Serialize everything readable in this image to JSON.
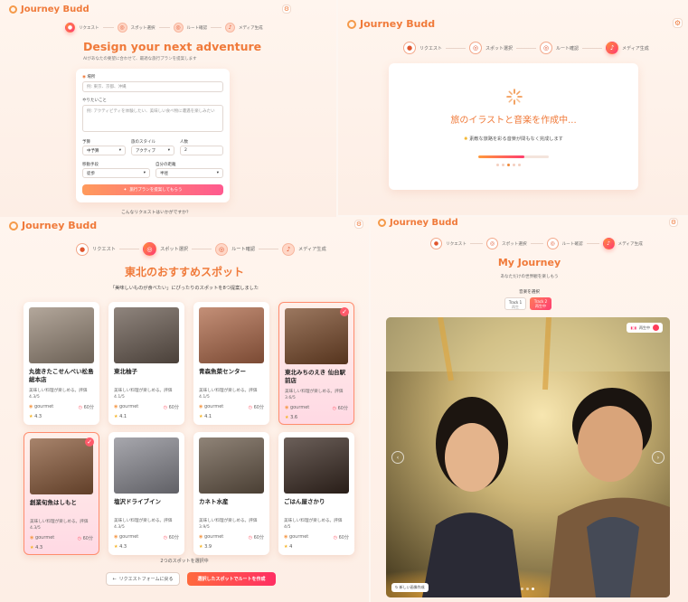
{
  "brand": {
    "name": "Journey Budd"
  },
  "steps": [
    "リクエスト",
    "スポット選択",
    "ルート確認",
    "メディア生成"
  ],
  "panel1": {
    "title": "Design your next adventure",
    "subtitle": "AIがあなたの要望に合わせて、最適な旅行プランを提案します",
    "destination_label": "場所",
    "destination_placeholder": "例: 東京、京都、沖縄",
    "request_label": "やりたいこと",
    "request_placeholder": "例: アクティビティを体験したい、美味しい食べ物に遭遇を楽しみたい",
    "budget_label": "予算",
    "budget_value": "中予算",
    "style_label": "旅のスタイル",
    "style_value": "アクティブ",
    "people_label": "人数",
    "people_value": "2",
    "transport_label": "移動手段",
    "transport_value": "徒歩",
    "distance_label": "自分の距離",
    "distance_value": "半径",
    "submit_label": "旅行プランを提案してもらう",
    "footer": "こんなリクエストはいかがですか？"
  },
  "panel2": {
    "title": "旅のイラストと音楽を作成中...",
    "subtitle": "素敵な旅路を彩る音楽が間もなく完成します",
    "progress": 0.65
  },
  "panel3": {
    "title": "東北のおすすめスポット",
    "subtitle": "「美味しいものが食べたい」にぴったりのスポットを8つ提案しました",
    "selected_count": "2つのスポットを選択中",
    "back_label": "リクエストフォームに戻る",
    "create_label": "選択したスポットでルートを作成",
    "spots": [
      {
        "name": "丸徳きたこせんべい松島総本店",
        "desc": "美味しい料理が楽しめる。評価 4.3/5",
        "tag": "gourmet",
        "time": "60分",
        "rating": "4.3",
        "selected": false,
        "color": "#9a8a7a"
      },
      {
        "name": "東北柚子",
        "desc": "美味しい料理が楽しめる。評価 4.1/5",
        "tag": "gourmet",
        "time": "60分",
        "rating": "4.1",
        "selected": false,
        "color": "#6a5c52"
      },
      {
        "name": "青森魚菜センター",
        "desc": "美味しい料理が楽しめる。評価 4.1/5",
        "tag": "gourmet",
        "time": "60分",
        "rating": "4.1",
        "selected": false,
        "color": "#b06a4a"
      },
      {
        "name": "東北みちのえき 仙台駅前店",
        "desc": "美味しい料理が楽しめる。評価 3.6/5",
        "tag": "gourmet",
        "time": "60分",
        "rating": "3.6",
        "selected": true,
        "color": "#7a4a2a"
      },
      {
        "name": "創業旬魚はしもと",
        "desc": "美味しい料理が楽しめる。評価 4.3/5",
        "tag": "gourmet",
        "time": "60分",
        "rating": "4.3",
        "selected": true,
        "color": "#8a5a3a"
      },
      {
        "name": "塩沢ドライブイン",
        "desc": "美味しい料理が楽しめる。評価 4.3/5",
        "tag": "gourmet",
        "time": "60分",
        "rating": "4.3",
        "selected": false,
        "color": "#8a8a92"
      },
      {
        "name": "カネト水産",
        "desc": "美味しい料理が楽しめる。評価 3.9/5",
        "tag": "gourmet",
        "time": "60分",
        "rating": "3.9",
        "selected": false,
        "color": "#6a5a4a"
      },
      {
        "name": "ごはん屋さかり",
        "desc": "美味しい料理が楽しめる。評価 4/5",
        "tag": "gourmet",
        "time": "60分",
        "rating": "4",
        "selected": false,
        "color": "#3a2a22"
      }
    ]
  },
  "panel4": {
    "title": "My Journey",
    "subtitle": "あなただけの世界観を楽しもう",
    "music_label": "音楽を選択",
    "track1": "Track 1",
    "track1_sub": "再生",
    "track2": "Track 2",
    "track2_sub": "再生中",
    "badge": "再生中",
    "new_illustration": "新しい画像作成"
  }
}
